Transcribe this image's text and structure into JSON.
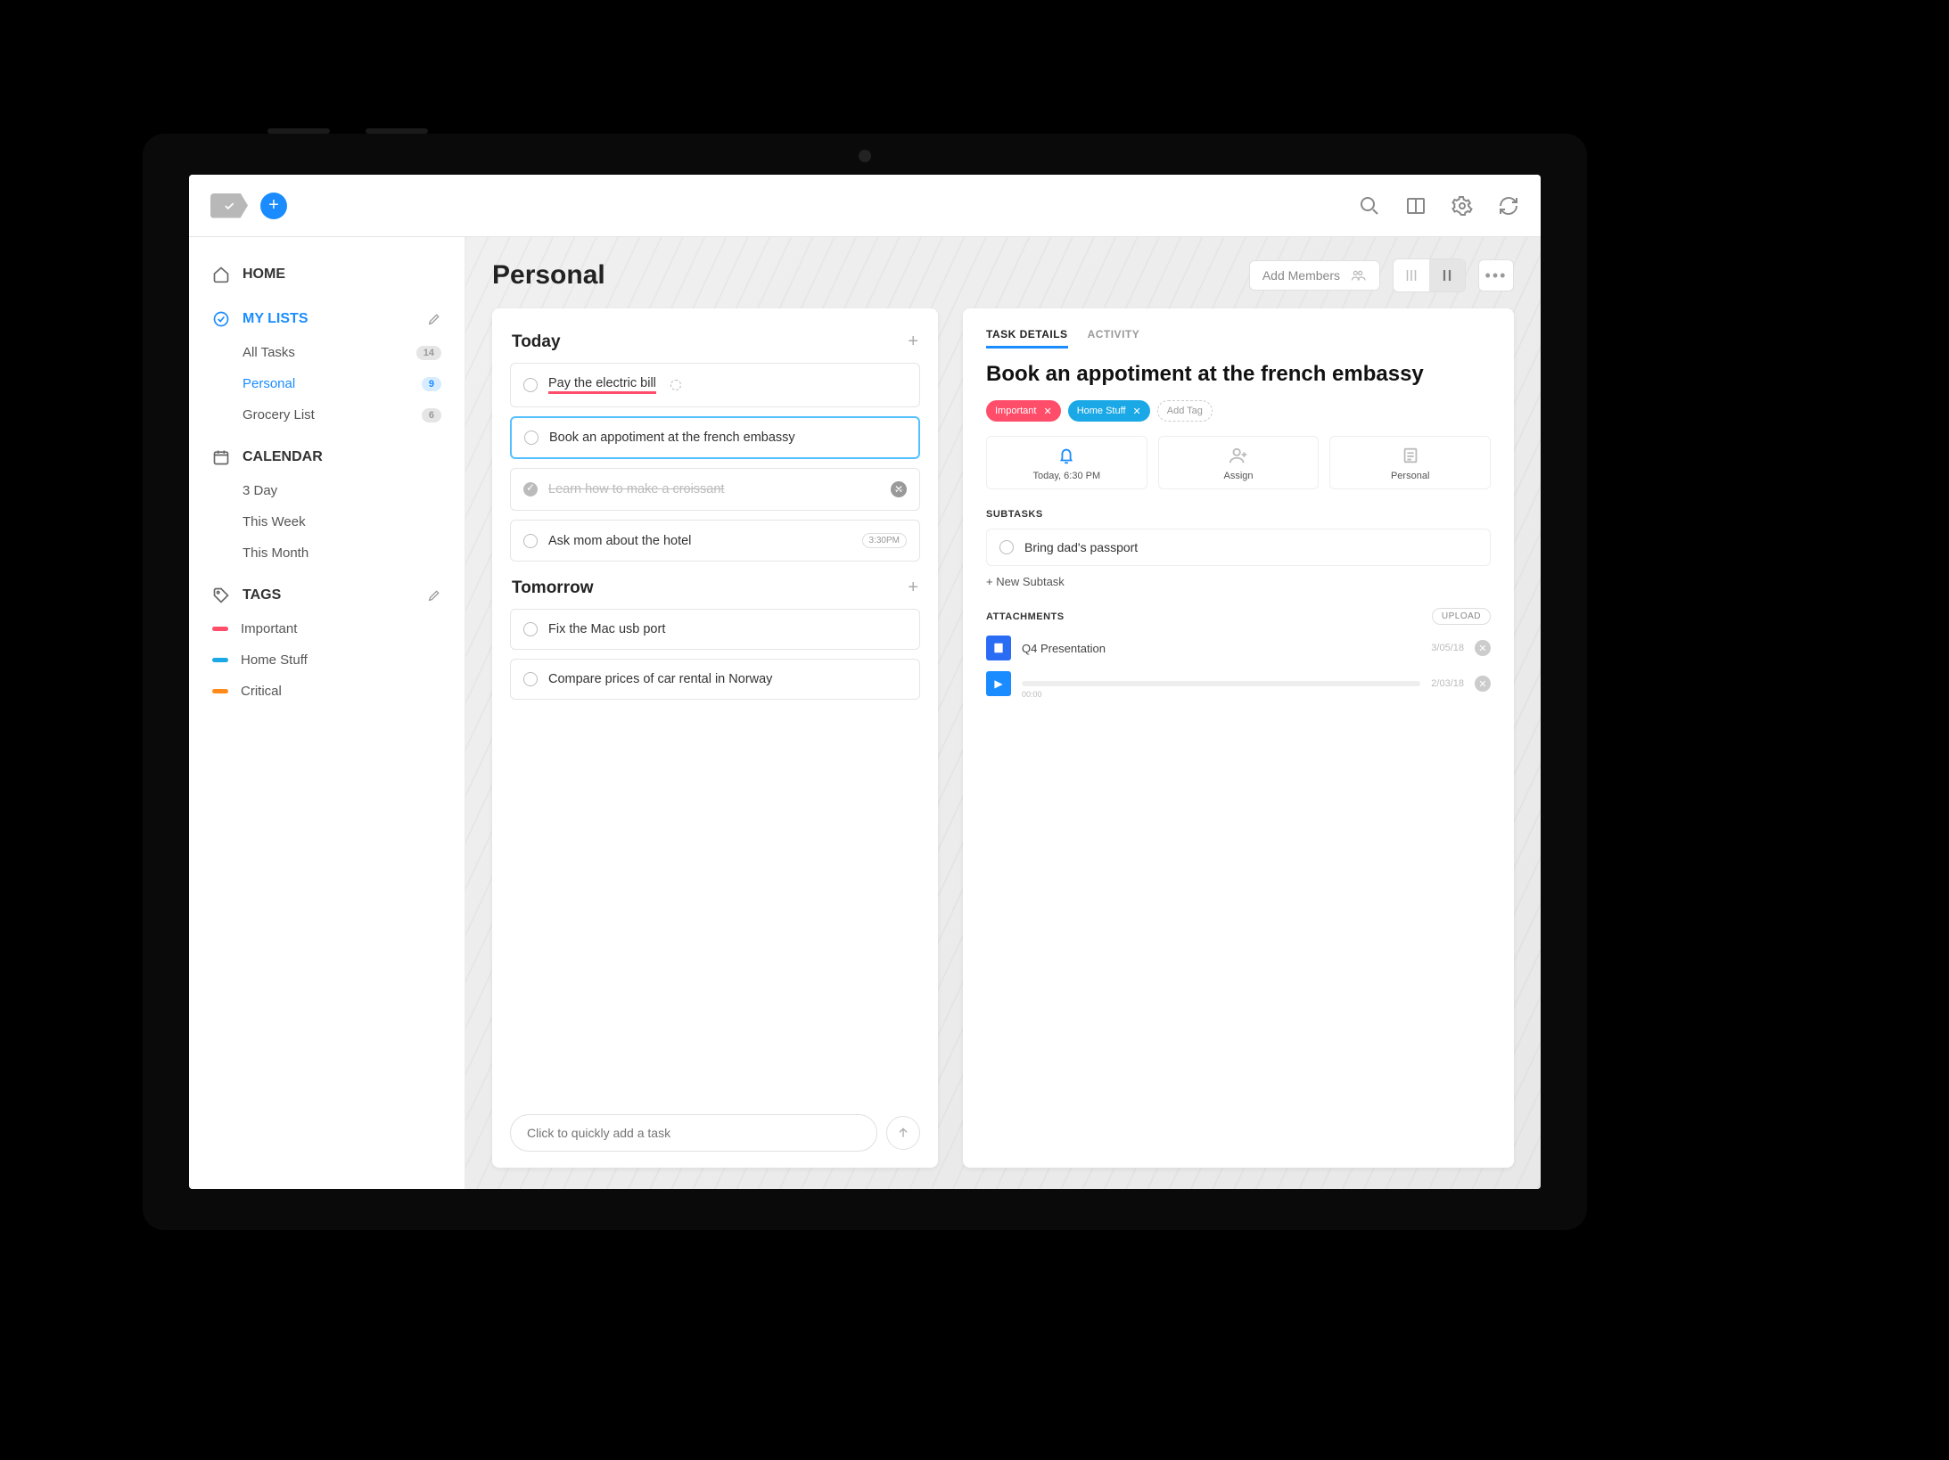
{
  "header": {
    "add_members": "Add Members"
  },
  "sidebar": {
    "home": "HOME",
    "mylists": "MY LISTS",
    "lists": [
      {
        "label": "All Tasks",
        "count": "14"
      },
      {
        "label": "Personal",
        "count": "9"
      },
      {
        "label": "Grocery List",
        "count": "6"
      }
    ],
    "calendar": "CALENDAR",
    "cal_items": [
      "3 Day",
      "This Week",
      "This Month"
    ],
    "tags_head": "TAGS",
    "tags": [
      {
        "label": "Important",
        "color": "#ff4d6a"
      },
      {
        "label": "Home Stuff",
        "color": "#1aa8e6"
      },
      {
        "label": "Critical",
        "color": "#ff8a1a"
      }
    ]
  },
  "main": {
    "title": "Personal",
    "groups": {
      "today": "Today",
      "tomorrow": "Tomorrow"
    },
    "today_tasks": {
      "t0": "Pay the electric bill",
      "t1": "Book an appotiment at the french embassy",
      "t2": "Learn how to make a croissant",
      "t3": "Ask mom about the hotel",
      "t3_chip": "3:30PM"
    },
    "tomorrow_tasks": {
      "t0": "Fix the Mac usb port",
      "t1": "Compare prices of car rental in Norway"
    },
    "quick_add_placeholder": "Click to quickly add a task"
  },
  "details": {
    "tabs": {
      "task": "TASK DETAILS",
      "activity": "ACTIVITY"
    },
    "title": "Book an appotiment at the french embassy",
    "tags": {
      "important": "Important",
      "home": "Home Stuff",
      "add": "Add Tag"
    },
    "info": {
      "when": "Today, 6:30 PM",
      "assign": "Assign",
      "list": "Personal"
    },
    "subtasks_head": "SUBTASKS",
    "subtask0": "Bring dad's passport",
    "new_subtask": "+ New Subtask",
    "attachments_head": "ATTACHMENTS",
    "upload": "UPLOAD",
    "att0": {
      "name": "Q4 Presentation",
      "date": "3/05/18"
    },
    "att1": {
      "time": "00:00",
      "date": "2/03/18"
    }
  }
}
